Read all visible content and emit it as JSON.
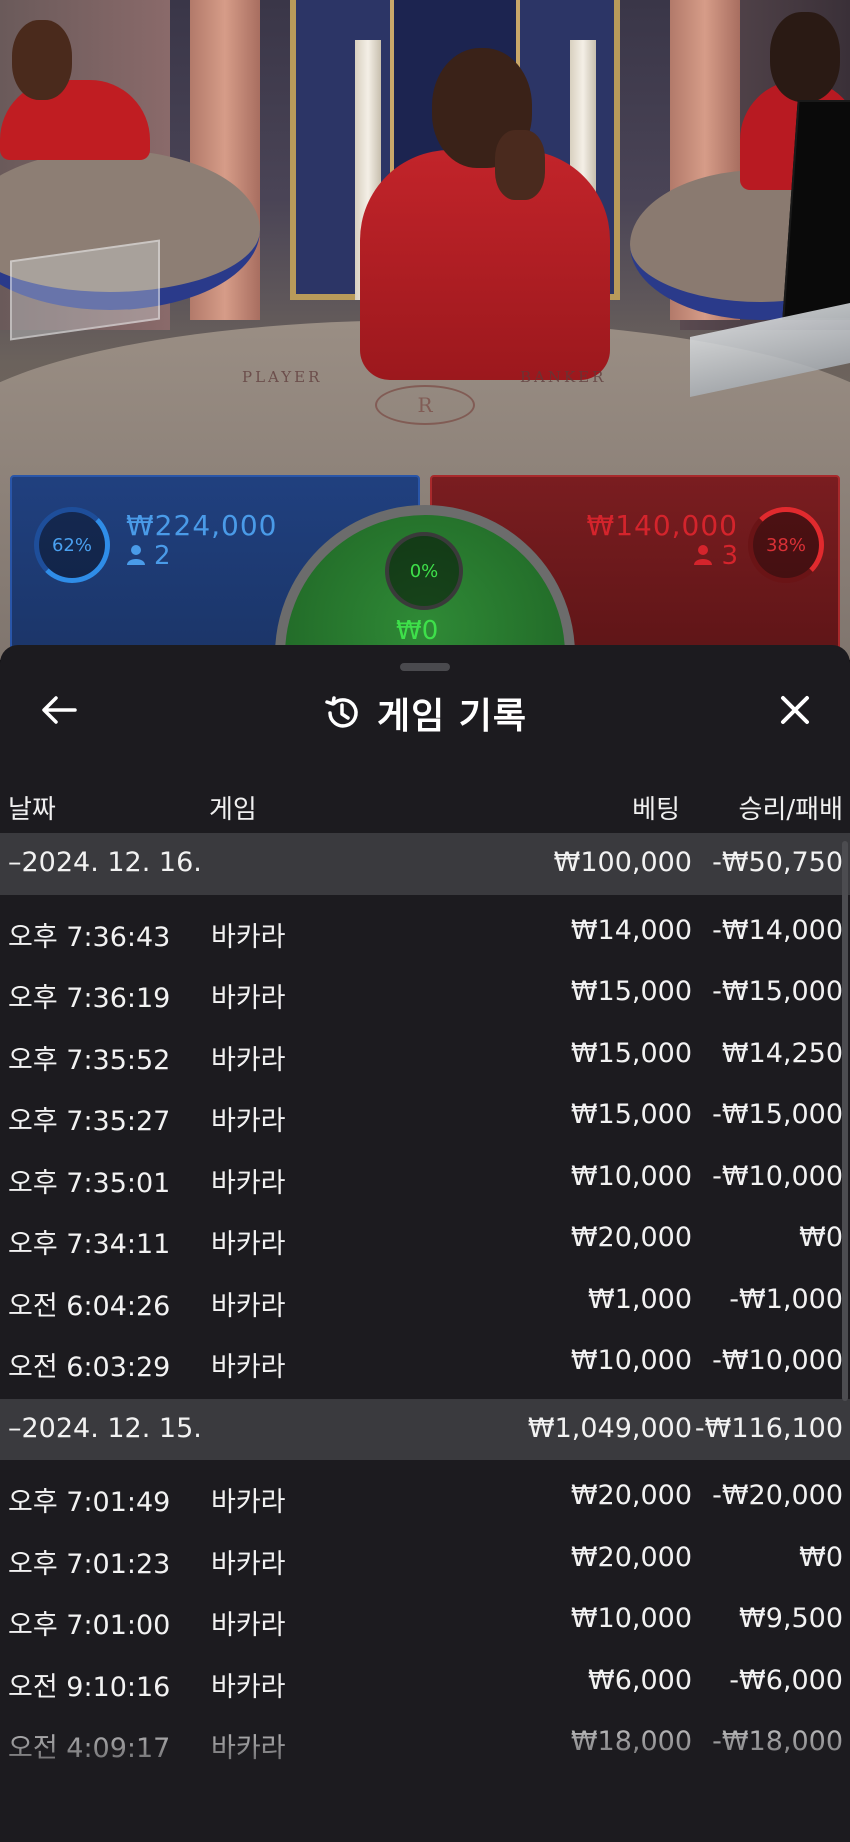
{
  "video": {
    "felt_player": "PLAYER",
    "felt_banker": "BANKER",
    "crest_letter": "R"
  },
  "betting": {
    "player": {
      "percent": "62%",
      "amount": "₩224,000",
      "count": "2",
      "color": "#2f8de8"
    },
    "banker": {
      "percent": "38%",
      "amount": "₩140,000",
      "count": "3",
      "color": "#e12a2e"
    },
    "tie": {
      "percent": "0%",
      "amount": "₩0",
      "color": "#3ee04a"
    }
  },
  "sheet": {
    "title": "게임 기록",
    "icons": {
      "back": "arrow-left-icon",
      "history": "history-icon",
      "close": "close-icon"
    },
    "columns": {
      "date": "날짜",
      "game": "게임",
      "bet": "베팅",
      "win_loss": "승리/패배"
    },
    "groups": [
      {
        "date": "–2024. 12. 16.",
        "total_bet": "₩100,000",
        "total_win_loss": "-₩50,750",
        "rows": [
          {
            "time": "오후 7:36:43",
            "game": "바카라",
            "bet": "₩14,000",
            "win_loss": "-₩14,000"
          },
          {
            "time": "오후 7:36:19",
            "game": "바카라",
            "bet": "₩15,000",
            "win_loss": "-₩15,000"
          },
          {
            "time": "오후 7:35:52",
            "game": "바카라",
            "bet": "₩15,000",
            "win_loss": "₩14,250"
          },
          {
            "time": "오후 7:35:27",
            "game": "바카라",
            "bet": "₩15,000",
            "win_loss": "-₩15,000"
          },
          {
            "time": "오후 7:35:01",
            "game": "바카라",
            "bet": "₩10,000",
            "win_loss": "-₩10,000"
          },
          {
            "time": "오후 7:34:11",
            "game": "바카라",
            "bet": "₩20,000",
            "win_loss": "₩0"
          },
          {
            "time": "오전 6:04:26",
            "game": "바카라",
            "bet": "₩1,000",
            "win_loss": "-₩1,000"
          },
          {
            "time": "오전 6:03:29",
            "game": "바카라",
            "bet": "₩10,000",
            "win_loss": "-₩10,000"
          }
        ]
      },
      {
        "date": "–2024. 12. 15.",
        "total_bet": "₩1,049,000",
        "total_win_loss": "-₩116,100",
        "rows": [
          {
            "time": "오후 7:01:49",
            "game": "바카라",
            "bet": "₩20,000",
            "win_loss": "-₩20,000"
          },
          {
            "time": "오후 7:01:23",
            "game": "바카라",
            "bet": "₩20,000",
            "win_loss": "₩0"
          },
          {
            "time": "오후 7:01:00",
            "game": "바카라",
            "bet": "₩10,000",
            "win_loss": "₩9,500"
          },
          {
            "time": "오전 9:10:16",
            "game": "바카라",
            "bet": "₩6,000",
            "win_loss": "-₩6,000"
          },
          {
            "time": "오전 4:09:17",
            "game": "바카라",
            "bet": "₩18,000",
            "win_loss": "-₩18,000"
          }
        ]
      }
    ]
  }
}
